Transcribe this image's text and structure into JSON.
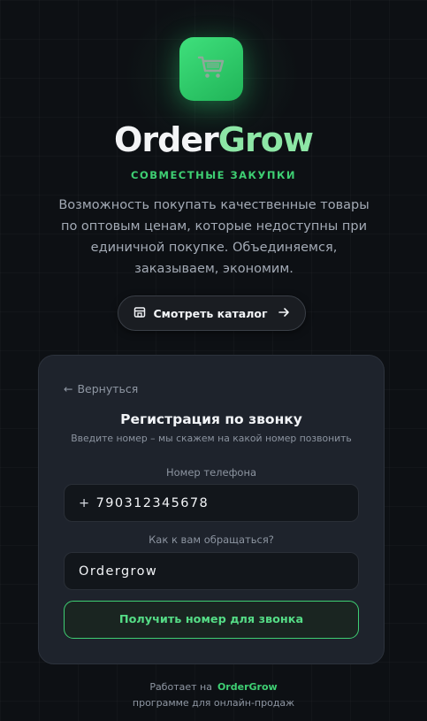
{
  "brand": {
    "name_part1": "Order",
    "name_part2": "Grow",
    "tagline": "СОВМЕСТНЫЕ ЗАКУПКИ",
    "description": "Возможность покупать качественные товары по оптовым ценам, которые недоступны при единичной покупке. Объединяемся, заказываем, экономим.",
    "logo_icon": "shopping-cart-icon"
  },
  "catalog_button": {
    "label": "Смотреть каталог",
    "icon_left": "store-icon",
    "icon_right": "arrow-right-icon"
  },
  "form": {
    "back_label": "Вернуться",
    "title": "Регистрация по звонку",
    "subtitle": "Введите номер – мы скажем на какой номер позвонить",
    "phone_label": "Номер телефона",
    "phone_prefix": "+",
    "phone_value": "790312345678",
    "name_label": "Как к вам обращаться?",
    "name_value": "Ordergrow",
    "submit_label": "Получить номер для звонка"
  },
  "footer": {
    "line1_prefix": "Работает на",
    "line1_brand": "OrderGrow",
    "line2": "программе для онлайн-продаж"
  },
  "colors": {
    "accent": "#3ecf73",
    "background": "#0d1014",
    "card": "#1e232c"
  }
}
